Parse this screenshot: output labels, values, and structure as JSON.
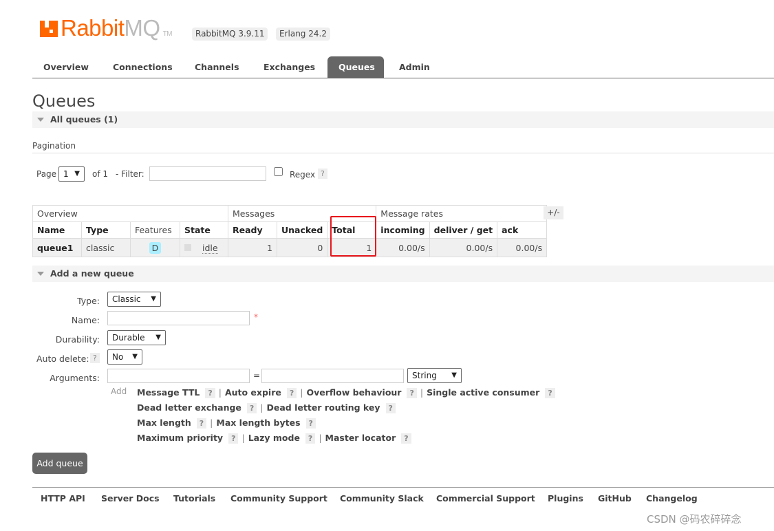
{
  "header": {
    "logo": {
      "part1": "Rabbit",
      "part2": "MQ",
      "tm": "TM"
    },
    "version": "RabbitMQ 3.9.11",
    "erlang": "Erlang 24.2"
  },
  "tabs": [
    "Overview",
    "Connections",
    "Channels",
    "Exchanges",
    "Queues",
    "Admin"
  ],
  "active_tab": "Queues",
  "page_title": "Queues",
  "all_queues": "All queues (1)",
  "pagination": {
    "label": "Pagination",
    "page_label": "Page",
    "page": "1",
    "of": "of 1",
    "filter_label": "- Filter:",
    "filter_value": "",
    "regex": "Regex",
    "help": "?"
  },
  "table": {
    "groups": [
      "Overview",
      "Messages",
      "Message rates"
    ],
    "toggle": "+/-",
    "columns": [
      "Name",
      "Type",
      "Features",
      "State",
      "Ready",
      "Unacked",
      "Total",
      "incoming",
      "deliver / get",
      "ack"
    ],
    "rows": [
      {
        "name": "queue1",
        "type": "classic",
        "features": "D",
        "state": "idle",
        "ready": "1",
        "unacked": "0",
        "total": "1",
        "incoming": "0.00/s",
        "deliver_get": "0.00/s",
        "ack": "0.00/s"
      }
    ],
    "highlight_color": "#e8161b"
  },
  "add_queue": {
    "title": "Add a new queue",
    "type_label": "Type:",
    "type_value": "Classic",
    "name_label": "Name:",
    "name_value": "",
    "required": "*",
    "durability_label": "Durability:",
    "durability_value": "Durable",
    "auto_delete_label": "Auto delete:",
    "auto_delete_value": "No",
    "arguments_label": "Arguments:",
    "equals": "=",
    "arg_type": "String",
    "add": "Add",
    "arg_lines": [
      [
        "Message TTL",
        "Auto expire",
        "Overflow behaviour",
        "Single active consumer"
      ],
      [
        "Dead letter exchange",
        "Dead letter routing key"
      ],
      [
        "Max length",
        "Max length bytes"
      ],
      [
        "Maximum priority",
        "Lazy mode",
        "Master locator"
      ]
    ],
    "submit": "Add queue"
  },
  "footer": [
    "HTTP API",
    "Server Docs",
    "Tutorials",
    "Community Support",
    "Community Slack",
    "Commercial Support",
    "Plugins",
    "GitHub",
    "Changelog"
  ],
  "watermark": "CSDN @码农碎碎念",
  "colors": {
    "brand": "#ff6600",
    "active_tab": "#666666"
  }
}
